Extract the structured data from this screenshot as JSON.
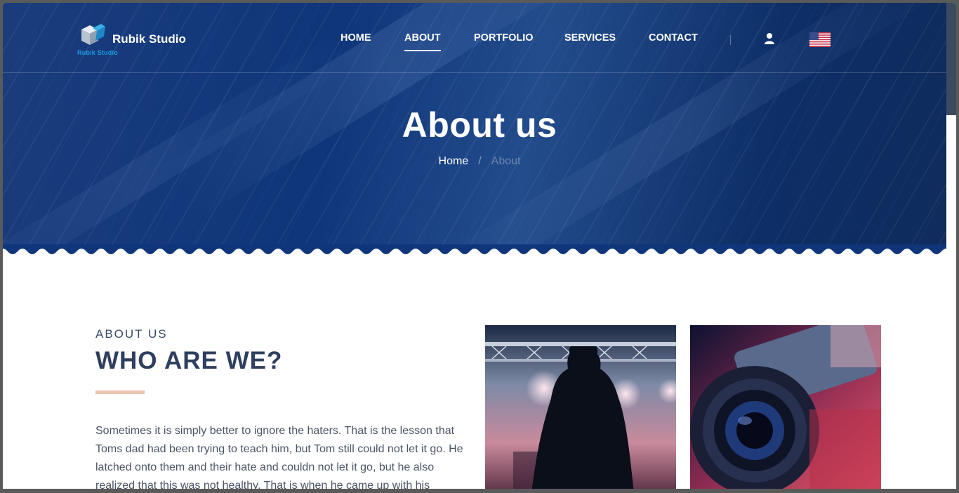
{
  "brand": {
    "name": "Rubik Studio",
    "logo_subtext": "Rubik Studio",
    "logo_icon": "cube-logo-icon"
  },
  "nav": {
    "items": [
      {
        "label": "HOME",
        "active": false
      },
      {
        "label": "ABOUT",
        "active": true
      },
      {
        "label": "PORTFOLIO",
        "active": false
      },
      {
        "label": "SERVICES",
        "active": false
      },
      {
        "label": "CONTACT",
        "active": false
      }
    ],
    "user_icon": "user-icon",
    "language_icon": "us-flag-icon"
  },
  "hero": {
    "title": "About us",
    "breadcrumb": {
      "home": "Home",
      "separator": "/",
      "current": "About"
    }
  },
  "about": {
    "eyebrow": "ABOUT US",
    "title": "WHO ARE WE?",
    "body": "Sometimes it is simply better to ignore the haters. That is the lesson that Toms dad had been trying to teach him, but Tom still could not let it go. He latched onto them and their hate and couldn not let it go, but he also realized that this was not healthy. That is when he came up with his"
  },
  "colors": {
    "hero_blue": "#0f367a",
    "heading_navy": "#2e3f60",
    "accent_peach": "#ecc5b2",
    "logo_blue": "#1e9be0"
  }
}
